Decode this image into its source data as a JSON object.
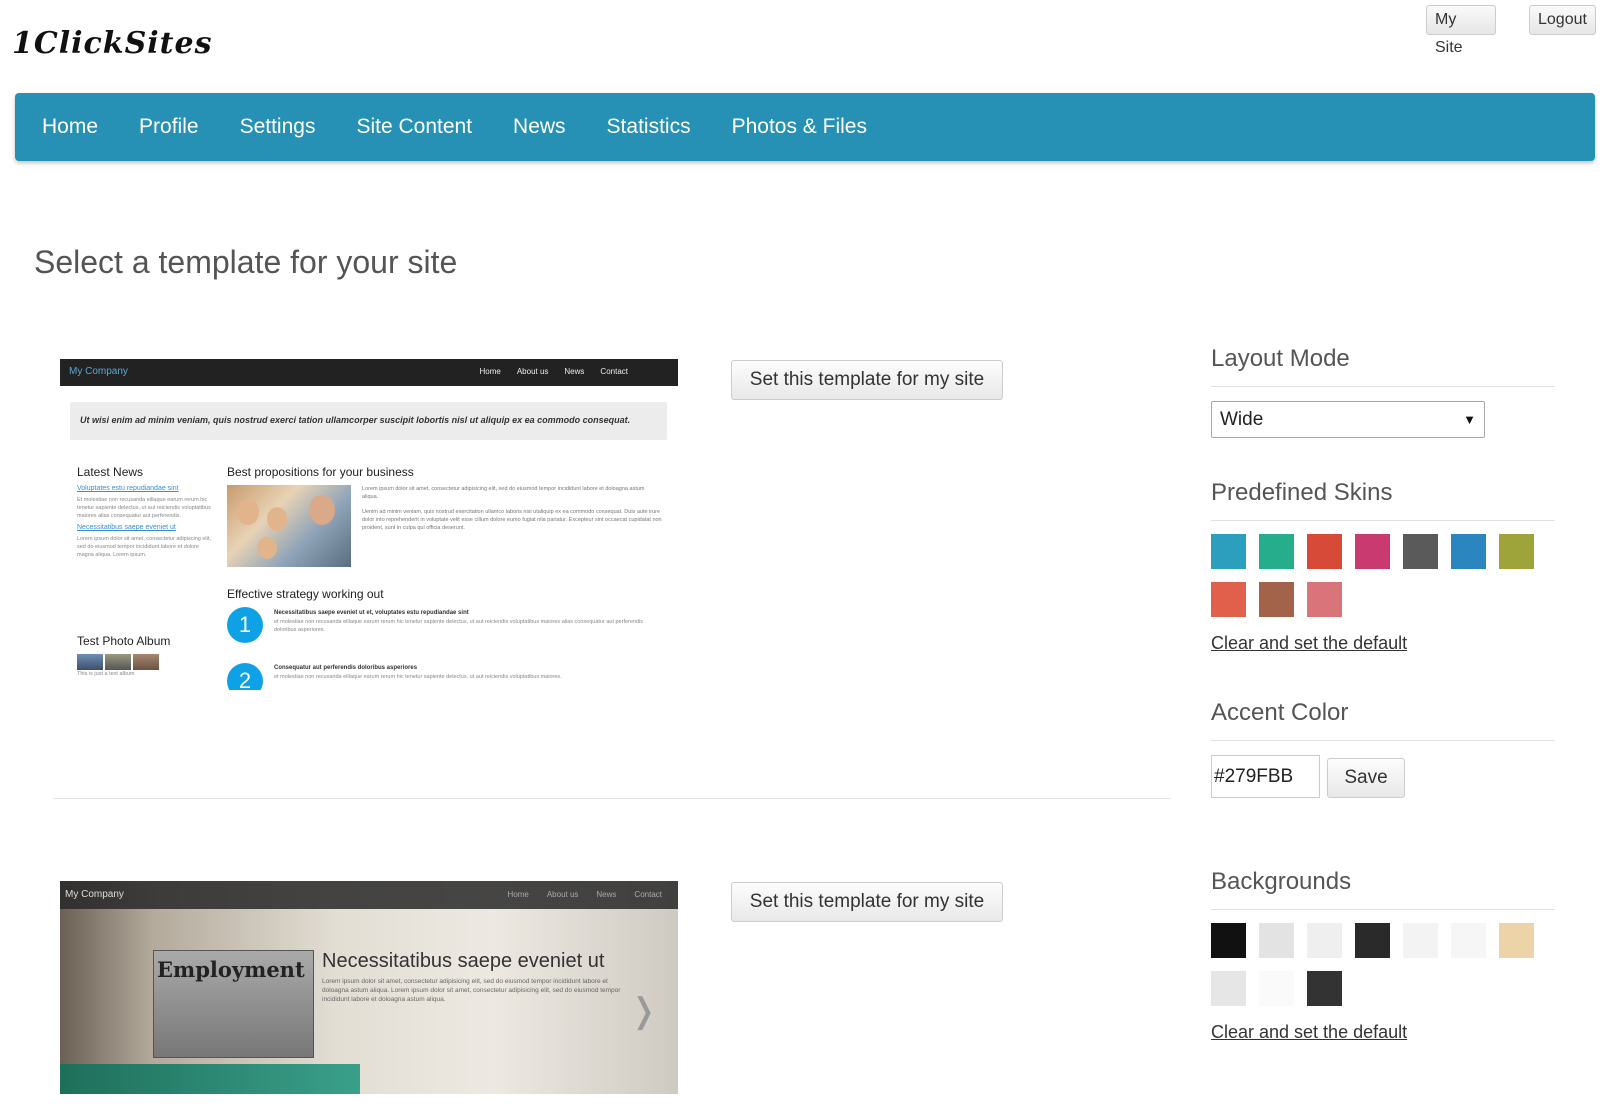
{
  "header": {
    "logo": "1ClickSites",
    "my_site": "My Site",
    "logout": "Logout"
  },
  "nav": [
    "Home",
    "Profile",
    "Settings",
    "Site Content",
    "News",
    "Statistics",
    "Photos & Files"
  ],
  "main": {
    "title": "Select a template for your site",
    "set_template_label": "Set this template for my site"
  },
  "preview1": {
    "brand": "My Company",
    "menu": [
      "Home",
      "About us",
      "News",
      "Contact"
    ],
    "hero": "Ut wisi enim ad minim veniam, quis nostrud exerci tation ullamcorper suscipit lobortis nisl ut aliquip ex ea commodo consequat.",
    "latest_news": "Latest News",
    "news_link1": "Voluptates estu repudiandae sint",
    "news_text1": "Et molestiae non recusanda eillaque earum rerum hic tenetur sapiente delectus, ut aut reiciendis voluptatibus maiores alias consequatur aut perferendis.",
    "news_link2": "Necessitatibus saepe eveniet ut",
    "news_text2": "Lorem ipsum dolor sit amet, consectetur adipiscing elit, sed do eiusmod tempor incididunt labore et dolore magna aliqua. Lorem ipsum.",
    "album_title": "Test Photo Album",
    "album_caption": "This is just a test album",
    "section1": "Best propositions for your business",
    "text1": "Lorem ipsum dolor sit amet, consectetur adipisicing elit, sed do eiusmod tempor incididunt labore et doloagna astum aliqua.",
    "text2": "Uenim ad minim veniam, quis nostrud exercitation ullamco laboris nisi utaliquip ex ea commodo consequat. Duis aute irure dolor into reprehenderit in voluptate velit esse cillum dolore eumo fugiat nila pariatur. Excepteur sint occaecat cupidatat non proident, sunt in culpa qui officia deserunt.",
    "section2": "Effective strategy working out",
    "item1_num": "1",
    "item1_title": "Necessitatibus saepe eveniet ut et, voluptates estu repudiandae sint",
    "item1_text": "et molestiae non recusanda eillaque earum rerum hic tenetur sapiente delectus, ut aut reiciendis voluptatibus maiores alias consequatur aut perferendis doloribus asperiores.",
    "item2_num": "2",
    "item2_title": "Consequatur aut perferendis doloribus asperiores",
    "item2_text": "et molestiae non recusanda eillaque earum rerum hic tenetur sapiente delectus, ut aut reiciendis voluptatibus maiores."
  },
  "preview2": {
    "brand": "My Company",
    "menu": [
      "Home",
      "About us",
      "News",
      "Contact"
    ],
    "newspaper_word": "Employment",
    "heading": "Necessitatibus saepe eveniet ut",
    "text": "Lorem ipsum dolor sit amet, consectetur adipisicing elit, sed do eiusmod tempor incididunt labore et doloagna astum aliqua. Lorem ipsum dolor sit amet, consectetur adipisicing elit, sed do eiusmod tempor incididunt labore et doloagna astum aliqua.",
    "arrow": "❭"
  },
  "sidebar": {
    "layout_mode_title": "Layout Mode",
    "layout_mode_value": "Wide",
    "skins_title": "Predefined Skins",
    "skins": [
      "#2d9fbe",
      "#26ad8c",
      "#d84a38",
      "#c93a70",
      "#5a5a5a",
      "#2b86bf",
      "#9ea33a",
      "#e0604b",
      "#a3634b",
      "#d9747a"
    ],
    "clear_default": "Clear and set the default",
    "accent_title": "Accent Color",
    "accent_value": "#279FBB",
    "save": "Save",
    "backgrounds_title": "Backgrounds",
    "backgrounds": [
      "#111111",
      "#e3e3e3",
      "#efefef",
      "#2a2a2a",
      "#f3f3f3",
      "#f6f6f6",
      "#ecd3a8",
      "#e6e6e6",
      "#fafafa",
      "#333333"
    ]
  }
}
